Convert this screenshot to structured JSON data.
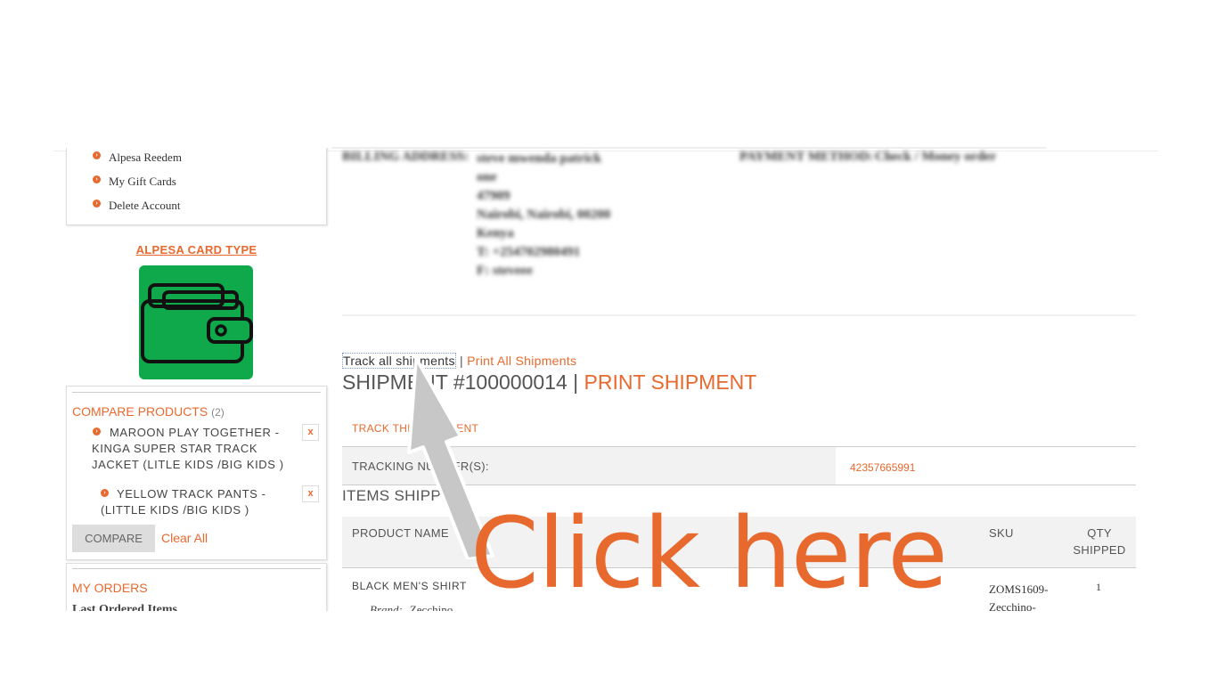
{
  "sidebar": {
    "account_items": [
      {
        "label": "Alpesa Reedem"
      },
      {
        "label": "My Gift Cards"
      },
      {
        "label": "Delete Account"
      }
    ],
    "card_type_title": "ALPESA CARD TYPE",
    "wallet_icon": "wallet-icon",
    "wallet_bg": "#0fa84a",
    "compare": {
      "title": "COMPARE PRODUCTS",
      "count": "(2)",
      "items": [
        {
          "name": "MAROON PLAY TOGETHER - KINGA SUPER STAR TRACK JACKET (LITLE KIDS /BIG KIDS )",
          "remove": "x"
        },
        {
          "name": "YELLOW TRACK PANTS - (LITTLE KIDS /BIG KIDS )",
          "remove": "x"
        }
      ],
      "compare_button": "COMPARE",
      "clear_all": "Clear All"
    },
    "orders": {
      "title": "MY ORDERS",
      "last_ordered": "Last Ordered Items"
    }
  },
  "billing": {
    "label": "BILLING ADDRESS:",
    "lines": [
      "steve mwenda patrick",
      "one",
      "47909",
      "Nairobi, Nairobi, 00200",
      "Kenya",
      "T: +254702980491",
      "F: steveee"
    ],
    "payment_label": "PAYMENT METHOD:",
    "payment_value": "Check / Money order"
  },
  "shipment": {
    "track_all": "Track all shipments",
    "separator": "|",
    "print_all": "Print All Shipments",
    "title": "SHIPMENT #100000014",
    "title_sep": "|",
    "print_shipment": "PRINT SHIPMENT",
    "track_this": "TRACK THIS SHIPMENT",
    "tracking_label": "TRACKING NUMBER(S):",
    "tracking_number": "42357665991",
    "items_shipped": "ITEMS SHIPPED",
    "columns": {
      "product": "PRODUCT NAME",
      "sku": "SKU",
      "qty_line1": "QTY",
      "qty_line2": "SHIPPED"
    },
    "rows": [
      {
        "product": "BLACK MEN'S SHIRT",
        "brand_label": "Brand:",
        "brand_value": "Zecchino",
        "sku_line1": "ZOMS1609-",
        "sku_line2": "Zecchino-",
        "qty": "1"
      }
    ]
  },
  "annotation": {
    "text": "Click here",
    "color": "#e8692e"
  },
  "colors": {
    "accent": "#e8692e"
  }
}
